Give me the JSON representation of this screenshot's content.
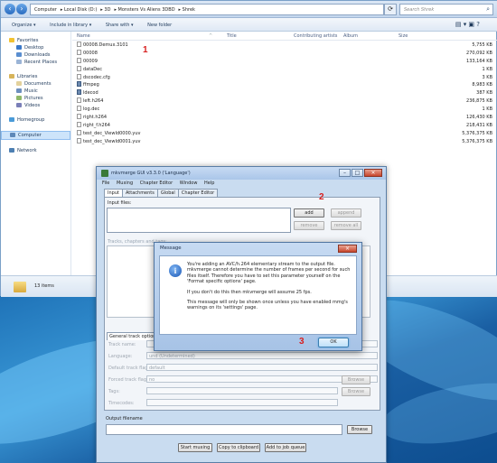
{
  "explorer": {
    "breadcrumbs": [
      "Computer",
      "Local Disk (D:)",
      "3D",
      "Monsters Vs Aliens 3DBD",
      "Shrek"
    ],
    "search_placeholder": "Search Shrek",
    "toolbar": {
      "organize": "Organize ▾",
      "include": "Include in library ▾",
      "share": "Share with ▾",
      "new_folder": "New folder"
    },
    "columns": {
      "name": "Name",
      "date": "Date modified",
      "title": "Title",
      "artists": "Contributing artists",
      "album": "Album",
      "size": "Size"
    },
    "nav": {
      "favorites": "Favorites",
      "fav_items": [
        "Desktop",
        "Downloads",
        "Recent Places"
      ],
      "libraries": "Libraries",
      "lib_items": [
        "Documents",
        "Music",
        "Pictures",
        "Videos"
      ],
      "homegroup": "Homegroup",
      "computer": "Computer",
      "network": "Network"
    },
    "files": [
      {
        "name": "00008.Demux.3101",
        "size": "5,755 KB",
        "exe": false
      },
      {
        "name": "00008",
        "size": "270,092 KB",
        "exe": false
      },
      {
        "name": "00009",
        "size": "133,164 KB",
        "exe": false
      },
      {
        "name": "dataDec",
        "size": "1 KB",
        "exe": false
      },
      {
        "name": "dscodec.cfg",
        "size": "3 KB",
        "exe": false
      },
      {
        "name": "ffmpeg",
        "size": "8,983 KB",
        "exe": true
      },
      {
        "name": "ldecod",
        "size": "387 KB",
        "exe": true
      },
      {
        "name": "left.h264",
        "size": "236,875 KB",
        "exe": false
      },
      {
        "name": "log.dec",
        "size": "1 KB",
        "exe": false
      },
      {
        "name": "right.h264",
        "size": "126,430 KB",
        "exe": false
      },
      {
        "name": "right_f.h264",
        "size": "218,431 KB",
        "exe": false
      },
      {
        "name": "test_dec_ViewId0000.yuv",
        "size": "5,376,375 KB",
        "exe": false
      },
      {
        "name": "test_dec_ViewId0001.yuv",
        "size": "5,376,375 KB",
        "exe": false
      }
    ],
    "status": "13 items"
  },
  "annotations": {
    "one": "1",
    "two": "2",
    "three": "3"
  },
  "mkvmerge": {
    "title": "mkvmerge GUI v3.3.0 ('Language')",
    "menu": [
      "File",
      "Muxing",
      "Chapter Editor",
      "Window",
      "Help"
    ],
    "tabs": [
      "Input",
      "Attachments",
      "Global",
      "Chapter Editor"
    ],
    "input_files_label": "Input files:",
    "buttons": {
      "add": "add",
      "append": "append",
      "remove": "remove",
      "remove_all": "remove all"
    },
    "tracks_label": "Tracks, chapters and tags:",
    "general_tab": "General track options",
    "fields": [
      {
        "label": "Track name:",
        "value": ""
      },
      {
        "label": "Language:",
        "value": "und (Undetermined)"
      },
      {
        "label": "Default track flag:",
        "value": "default"
      },
      {
        "label": "Forced track flag:",
        "value": "no"
      },
      {
        "label": "Tags:",
        "value": ""
      },
      {
        "label": "Timecodes:",
        "value": ""
      }
    ],
    "browse": "Browse",
    "output_label": "Output filename",
    "output_browse": "Browse",
    "actions": {
      "start": "Start muxing",
      "copy": "Copy to clipboard",
      "queue": "Add to job queue"
    }
  },
  "message": {
    "title": "Message",
    "p1": "You're adding an AVC/h.264 elementary stream to the output file. mkvmerge cannot determine the number of frames per second for such files itself. Therefore you have to set this parameter yourself on the 'Format specific options' page.",
    "p2": "If you don't do this then mkvmerge will assume 25 fps.",
    "p3": "This message will only be shown once unless you have enabled mmg's warnings on its 'settings' page.",
    "ok": "OK"
  }
}
